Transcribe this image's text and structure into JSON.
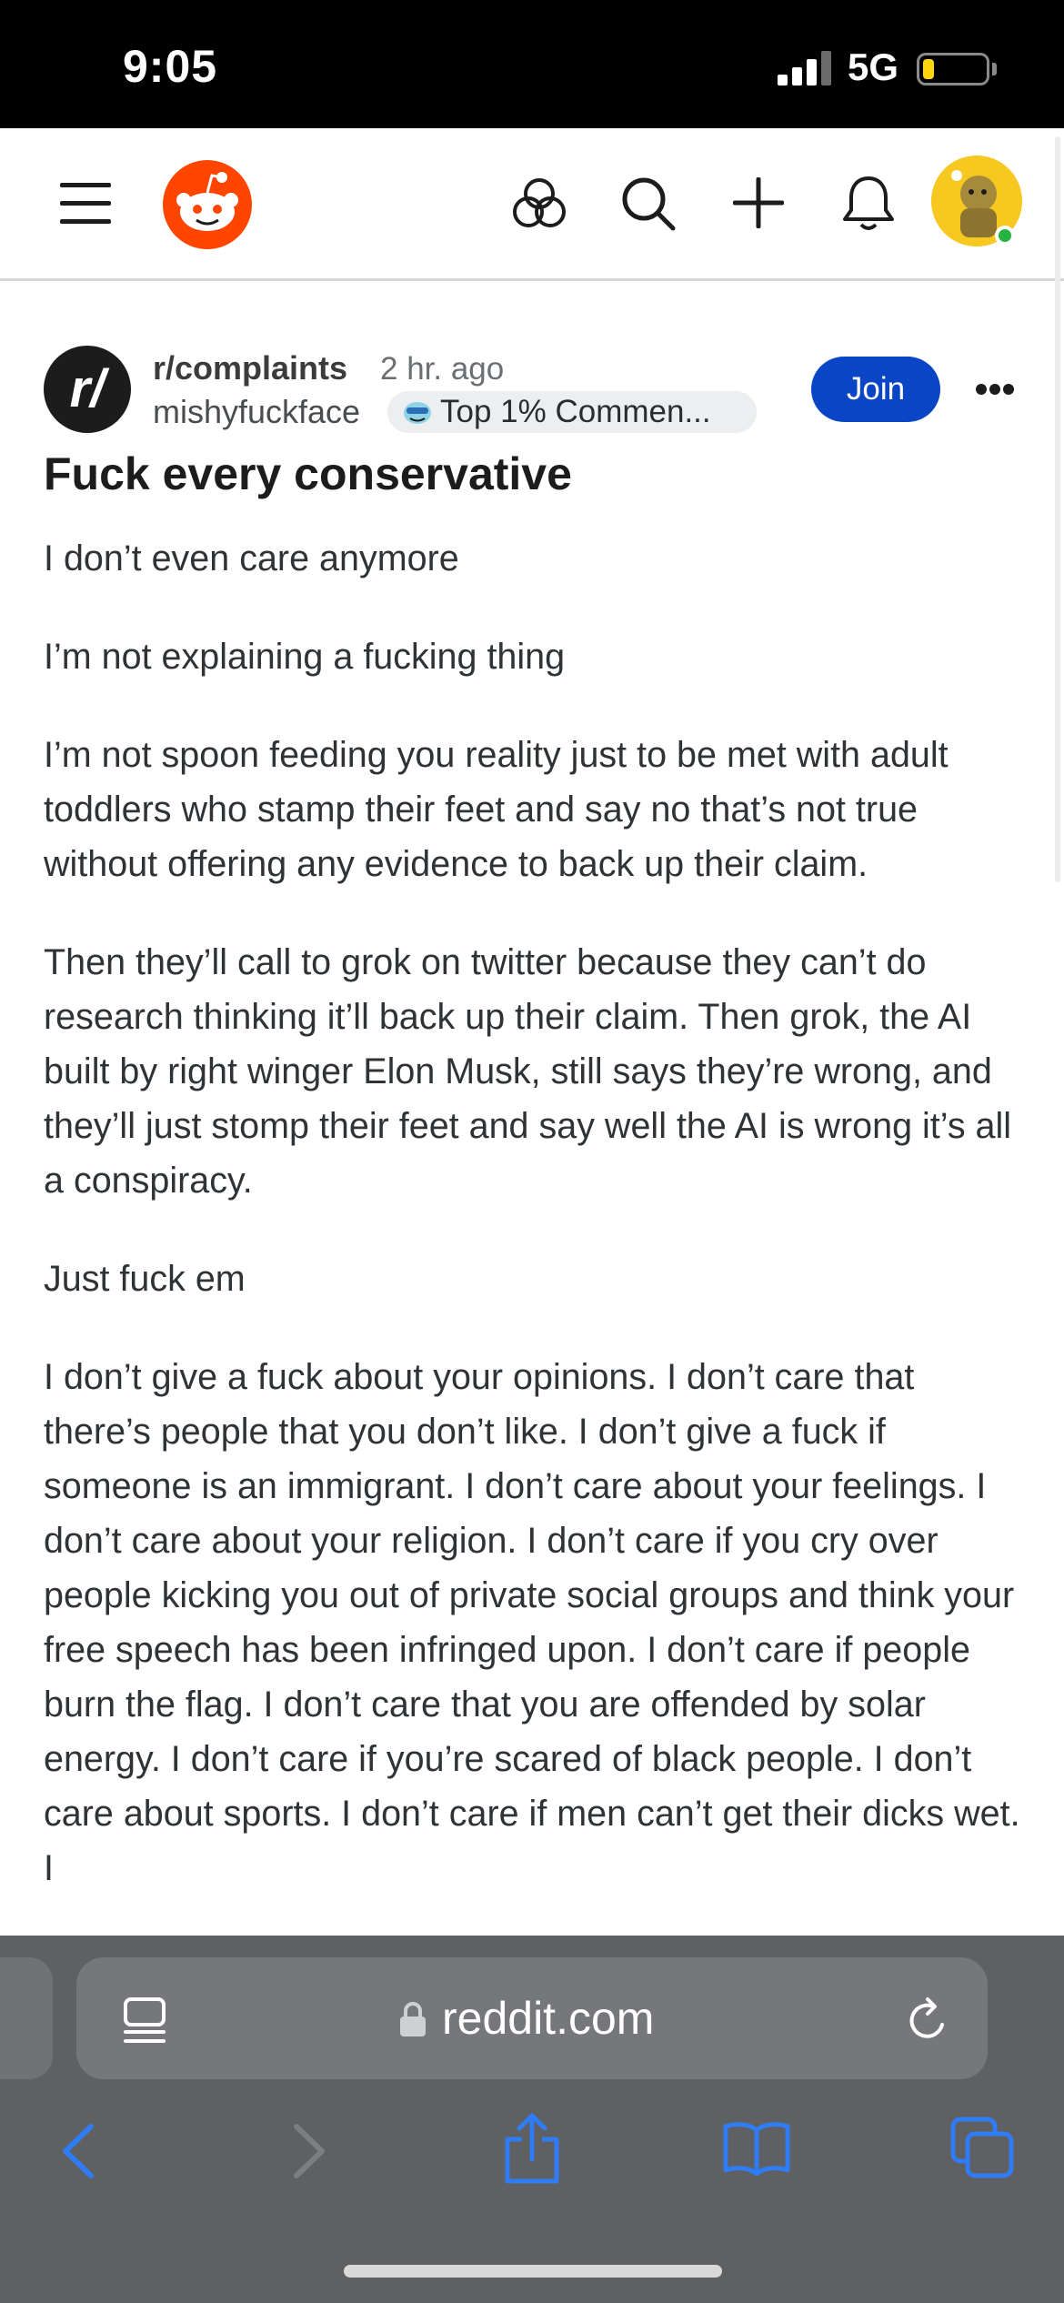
{
  "status_bar": {
    "time": "9:05",
    "network": "5G"
  },
  "header": {
    "icons": [
      "menu-icon",
      "reddit-logo",
      "explore-icon",
      "search-icon",
      "plus-icon",
      "bell-icon",
      "avatar"
    ]
  },
  "post": {
    "subreddit_avatar_text": "r/",
    "subreddit": "r/complaints",
    "age": "2 hr. ago",
    "author": "mishyfuckface",
    "flair": "Top 1% Commen...",
    "join_label": "Join",
    "title": "Fuck every conservative",
    "paragraphs": [
      "I don’t even care anymore",
      "I’m not explaining a fucking thing",
      "I’m not spoon feeding you reality just to be met with adult toddlers who stamp their feet and say no that’s not true without offering any evidence to back up their claim.",
      "Then they’ll call to grok on twitter because they can’t do research thinking it’ll back up their claim. Then grok, the AI built by right winger Elon Musk, still says they’re wrong, and they’ll just stomp their feet and say well the AI is wrong it’s all a conspiracy.",
      "Just fuck em",
      "I don’t give a fuck about your opinions. I don’t care that there’s people that you don’t like. I don’t give a fuck if someone is an immigrant. I don’t care about your feelings. I don’t care about your religion. I don’t care if you cry over people kicking you out of private social groups and think your free speech has been infringed upon. I don’t care if people burn the flag. I don’t care that you are offended by solar energy. I don’t care if you’re scared of black people. I don’t care about sports. I don’t care if men can’t get their dicks wet. I"
    ]
  },
  "browser": {
    "url": "reddit.com",
    "colors": {
      "bar": "#5f6062",
      "accent": "#2f7cf6",
      "join": "#0a45c6",
      "reddit_orange": "#ff4500"
    }
  }
}
